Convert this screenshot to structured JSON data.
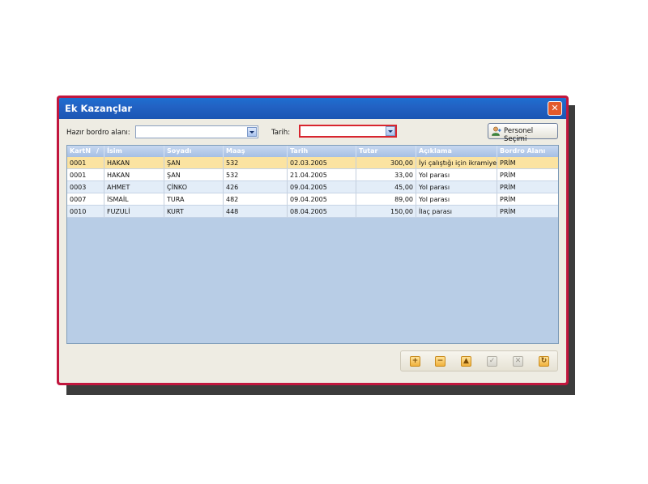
{
  "window": {
    "title": "Ek Kazançlar",
    "close_glyph": "✕"
  },
  "filters": {
    "bordro_label": "Hazır bordro alanı:",
    "bordro_value": "",
    "tarih_label": "Tarih:",
    "tarih_value": ""
  },
  "personnel_button": {
    "label": "Personel Seçimi",
    "icon": "person-icon"
  },
  "grid": {
    "columns": [
      "KartN",
      "İsim",
      "Soyadı",
      "Maaş",
      "Tarih",
      "Tutar",
      "Açıklama",
      "Bordro Alanı"
    ],
    "sort_glyph": "/",
    "rows": [
      [
        "0001",
        "HAKAN",
        "ŞAN",
        "532",
        "02.03.2005",
        "300,00",
        "İyi çalıştığı için ikramiye",
        "PRİM"
      ],
      [
        "0001",
        "HAKAN",
        "ŞAN",
        "532",
        "21.04.2005",
        "33,00",
        "Yol parası",
        "PRİM"
      ],
      [
        "0003",
        "AHMET",
        "ÇİNKO",
        "426",
        "09.04.2005",
        "45,00",
        "Yol parası",
        "PRİM"
      ],
      [
        "0007",
        "İSMAİL",
        "TURA",
        "482",
        "09.04.2005",
        "89,00",
        "Yol parası",
        "PRİM"
      ],
      [
        "0010",
        "FUZULİ",
        "KURT",
        "448",
        "08.04.2005",
        "150,00",
        "İlaç parası",
        "PRİM"
      ]
    ]
  },
  "navigator": {
    "buttons": [
      {
        "name": "add-record-button",
        "glyph": "+",
        "enabled": true
      },
      {
        "name": "delete-record-button",
        "glyph": "−",
        "enabled": true
      },
      {
        "name": "edit-record-button",
        "glyph": "▲",
        "enabled": true
      },
      {
        "name": "post-record-button",
        "glyph": "✓",
        "enabled": false
      },
      {
        "name": "cancel-record-button",
        "glyph": "✕",
        "enabled": false
      },
      {
        "name": "refresh-record-button",
        "glyph": "↻",
        "enabled": true
      }
    ]
  },
  "colors": {
    "window_border": "#c1163e",
    "titlebar": "#2262c4",
    "selected_row": "#fbe3a1",
    "grid_background": "#b8cde6"
  }
}
